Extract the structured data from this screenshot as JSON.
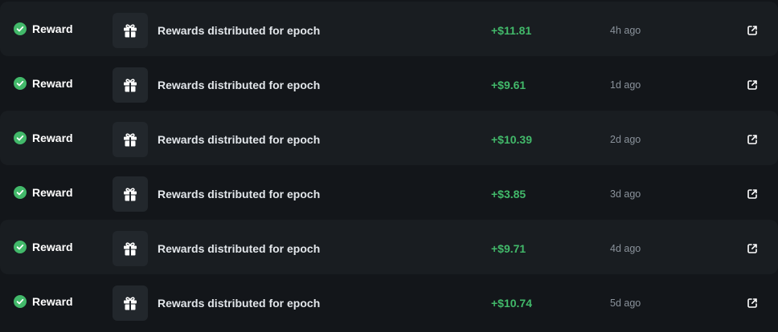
{
  "colors": {
    "background": "#13161a",
    "row_alt": "#191d21",
    "success_green": "#42b96a",
    "muted_text": "#8a929b"
  },
  "rows": [
    {
      "status": "Reward",
      "icon": "gift-icon",
      "description": "Rewards distributed for epoch",
      "amount": "+$11.81",
      "time": "4h ago"
    },
    {
      "status": "Reward",
      "icon": "gift-icon",
      "description": "Rewards distributed for epoch",
      "amount": "+$9.61",
      "time": "1d ago"
    },
    {
      "status": "Reward",
      "icon": "gift-icon",
      "description": "Rewards distributed for epoch",
      "amount": "+$10.39",
      "time": "2d ago"
    },
    {
      "status": "Reward",
      "icon": "gift-icon",
      "description": "Rewards distributed for epoch",
      "amount": "+$3.85",
      "time": "3d ago"
    },
    {
      "status": "Reward",
      "icon": "gift-icon",
      "description": "Rewards distributed for epoch",
      "amount": "+$9.71",
      "time": "4d ago"
    },
    {
      "status": "Reward",
      "icon": "gift-icon",
      "description": "Rewards distributed for epoch",
      "amount": "+$10.74",
      "time": "5d ago"
    }
  ]
}
